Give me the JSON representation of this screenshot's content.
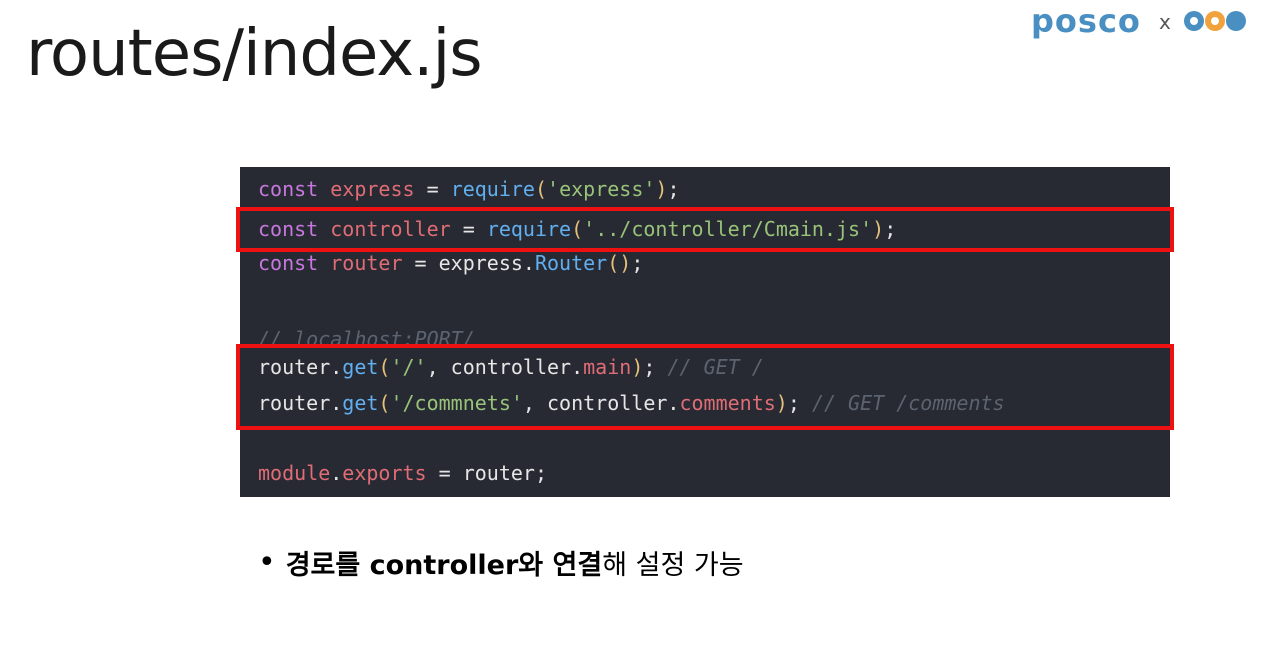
{
  "title": "routes/index.js",
  "brand": {
    "name": "posco",
    "separator": "x",
    "mark_icon": "partner-logo-icon",
    "color": "#4a8fc2"
  },
  "code": {
    "background": "#272a33",
    "lines": [
      [
        {
          "t": "const",
          "c": "kw"
        },
        {
          "t": " ",
          "c": "plain"
        },
        {
          "t": "express",
          "c": "var"
        },
        {
          "t": " = ",
          "c": "plain"
        },
        {
          "t": "require",
          "c": "fn"
        },
        {
          "t": "(",
          "c": "paren"
        },
        {
          "t": "'express'",
          "c": "str"
        },
        {
          "t": ")",
          "c": "paren"
        },
        {
          "t": ";",
          "c": "plain"
        }
      ],
      [
        {
          "t": "const",
          "c": "kw"
        },
        {
          "t": " ",
          "c": "plain"
        },
        {
          "t": "controller",
          "c": "var"
        },
        {
          "t": " = ",
          "c": "plain"
        },
        {
          "t": "require",
          "c": "fn"
        },
        {
          "t": "(",
          "c": "paren"
        },
        {
          "t": "'../controller/Cmain.js'",
          "c": "str"
        },
        {
          "t": ")",
          "c": "paren"
        },
        {
          "t": ";",
          "c": "plain"
        }
      ],
      [
        {
          "t": "const",
          "c": "kw"
        },
        {
          "t": " ",
          "c": "plain"
        },
        {
          "t": "router",
          "c": "var"
        },
        {
          "t": " = express.",
          "c": "plain"
        },
        {
          "t": "Router",
          "c": "fn"
        },
        {
          "t": "()",
          "c": "paren"
        },
        {
          "t": ";",
          "c": "plain"
        }
      ],
      [],
      [
        {
          "t": "// localhost:PORT/",
          "c": "comment"
        }
      ],
      [
        {
          "t": "router.",
          "c": "plain"
        },
        {
          "t": "get",
          "c": "fn"
        },
        {
          "t": "(",
          "c": "paren"
        },
        {
          "t": "'/'",
          "c": "str"
        },
        {
          "t": ", controller.",
          "c": "plain"
        },
        {
          "t": "main",
          "c": "prop"
        },
        {
          "t": ")",
          "c": "paren"
        },
        {
          "t": "; ",
          "c": "plain"
        },
        {
          "t": "// GET /",
          "c": "comment"
        }
      ],
      [
        {
          "t": "router.",
          "c": "plain"
        },
        {
          "t": "get",
          "c": "fn"
        },
        {
          "t": "(",
          "c": "paren"
        },
        {
          "t": "'/commnets'",
          "c": "str"
        },
        {
          "t": ", controller.",
          "c": "plain"
        },
        {
          "t": "comments",
          "c": "prop"
        },
        {
          "t": ")",
          "c": "paren"
        },
        {
          "t": "; ",
          "c": "plain"
        },
        {
          "t": "// GET /comments",
          "c": "comment"
        }
      ],
      [],
      [
        {
          "t": "module",
          "c": "var"
        },
        {
          "t": ".",
          "c": "plain"
        },
        {
          "t": "exports",
          "c": "var"
        },
        {
          "t": " = router;",
          "c": "plain"
        }
      ]
    ],
    "highlight_color": "#ee1111"
  },
  "bullet": {
    "marker": "•",
    "bold_text": "경로를 controller와 연결",
    "normal_text": "해 설정 가능"
  }
}
